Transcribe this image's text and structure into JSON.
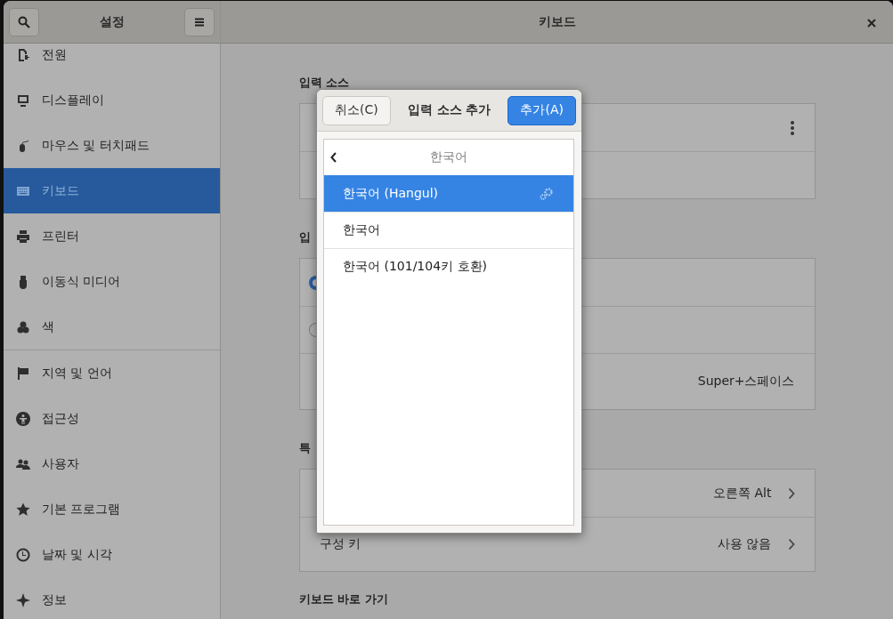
{
  "window": {
    "sidebar_title": "설정",
    "title": "키보드"
  },
  "sidebar": {
    "groups": [
      [
        {
          "label": "전원",
          "selected": false
        },
        {
          "label": "디스플레이",
          "selected": false
        },
        {
          "label": "마우스 및 터치패드",
          "selected": false
        },
        {
          "label": "키보드",
          "selected": true
        },
        {
          "label": "프린터",
          "selected": false
        },
        {
          "label": "이동식 미디어",
          "selected": false
        },
        {
          "label": "색",
          "selected": false
        }
      ],
      [
        {
          "label": "지역 및 언어",
          "selected": false
        },
        {
          "label": "접근성",
          "selected": false
        },
        {
          "label": "사용자",
          "selected": false
        },
        {
          "label": "기본 프로그램",
          "selected": false
        },
        {
          "label": "날짜 및 시각",
          "selected": false
        },
        {
          "label": "정보",
          "selected": false
        }
      ]
    ]
  },
  "content": {
    "sections": [
      {
        "heading": "입력 소스",
        "rows": [
          {
            "kind": "menu"
          },
          {
            "kind": "blank"
          }
        ]
      },
      {
        "heading": "입",
        "rows": [
          {
            "kind": "radio",
            "checked": true
          },
          {
            "kind": "radio",
            "checked": false
          },
          {
            "kind": "value",
            "value": "Super+스페이스"
          }
        ]
      },
      {
        "heading": "특",
        "rows": [
          {
            "kind": "link",
            "value": "오른쪽 Alt"
          },
          {
            "kind": "link",
            "label": "구성 키",
            "value": "사용 않음"
          }
        ]
      },
      {
        "heading": "키보드 바로 가기"
      }
    ]
  },
  "dialog": {
    "cancel": "취소(C)",
    "title": "입력 소스 추가",
    "add": "추가(A)",
    "list_title": "한국어",
    "items": [
      {
        "label": "한국어 (Hangul)",
        "selected": true,
        "configurable": true
      },
      {
        "label": "한국어",
        "selected": false,
        "configurable": false
      },
      {
        "label": "한국어 (101/104키 호환)",
        "selected": false,
        "configurable": false
      }
    ]
  }
}
